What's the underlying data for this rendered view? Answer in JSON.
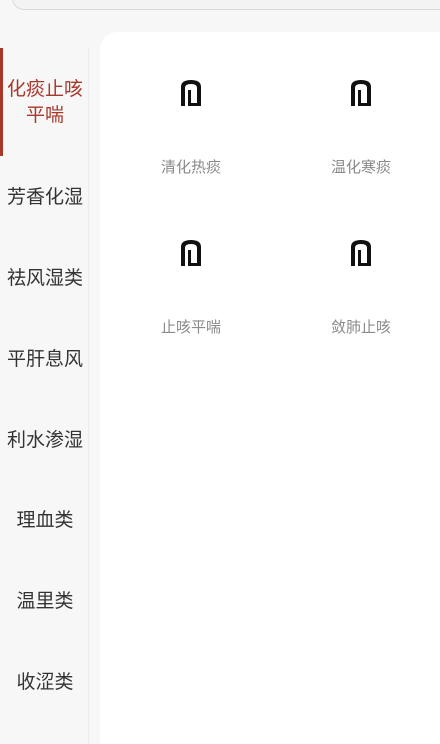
{
  "categories": [
    {
      "label": "化痰止咳平喘",
      "active": true
    },
    {
      "label": "芳香化湿",
      "active": false
    },
    {
      "label": "祛风湿类",
      "active": false
    },
    {
      "label": "平肝息风",
      "active": false
    },
    {
      "label": "利水渗湿",
      "active": false
    },
    {
      "label": "理血类",
      "active": false
    },
    {
      "label": "温里类",
      "active": false
    },
    {
      "label": "收涩类",
      "active": false
    }
  ],
  "subcategories": [
    {
      "label": "清化热痰",
      "icon": "placeholder-image-icon"
    },
    {
      "label": "温化寒痰",
      "icon": "placeholder-image-icon"
    },
    {
      "label": "止咳平喘",
      "icon": "placeholder-image-icon"
    },
    {
      "label": "敛肺止咳",
      "icon": "placeholder-image-icon"
    }
  ],
  "colors": {
    "accent": "#a8372c",
    "text": "#333333",
    "muted": "#8a8a8a",
    "background": "#f7f7f7",
    "panel": "#ffffff"
  }
}
